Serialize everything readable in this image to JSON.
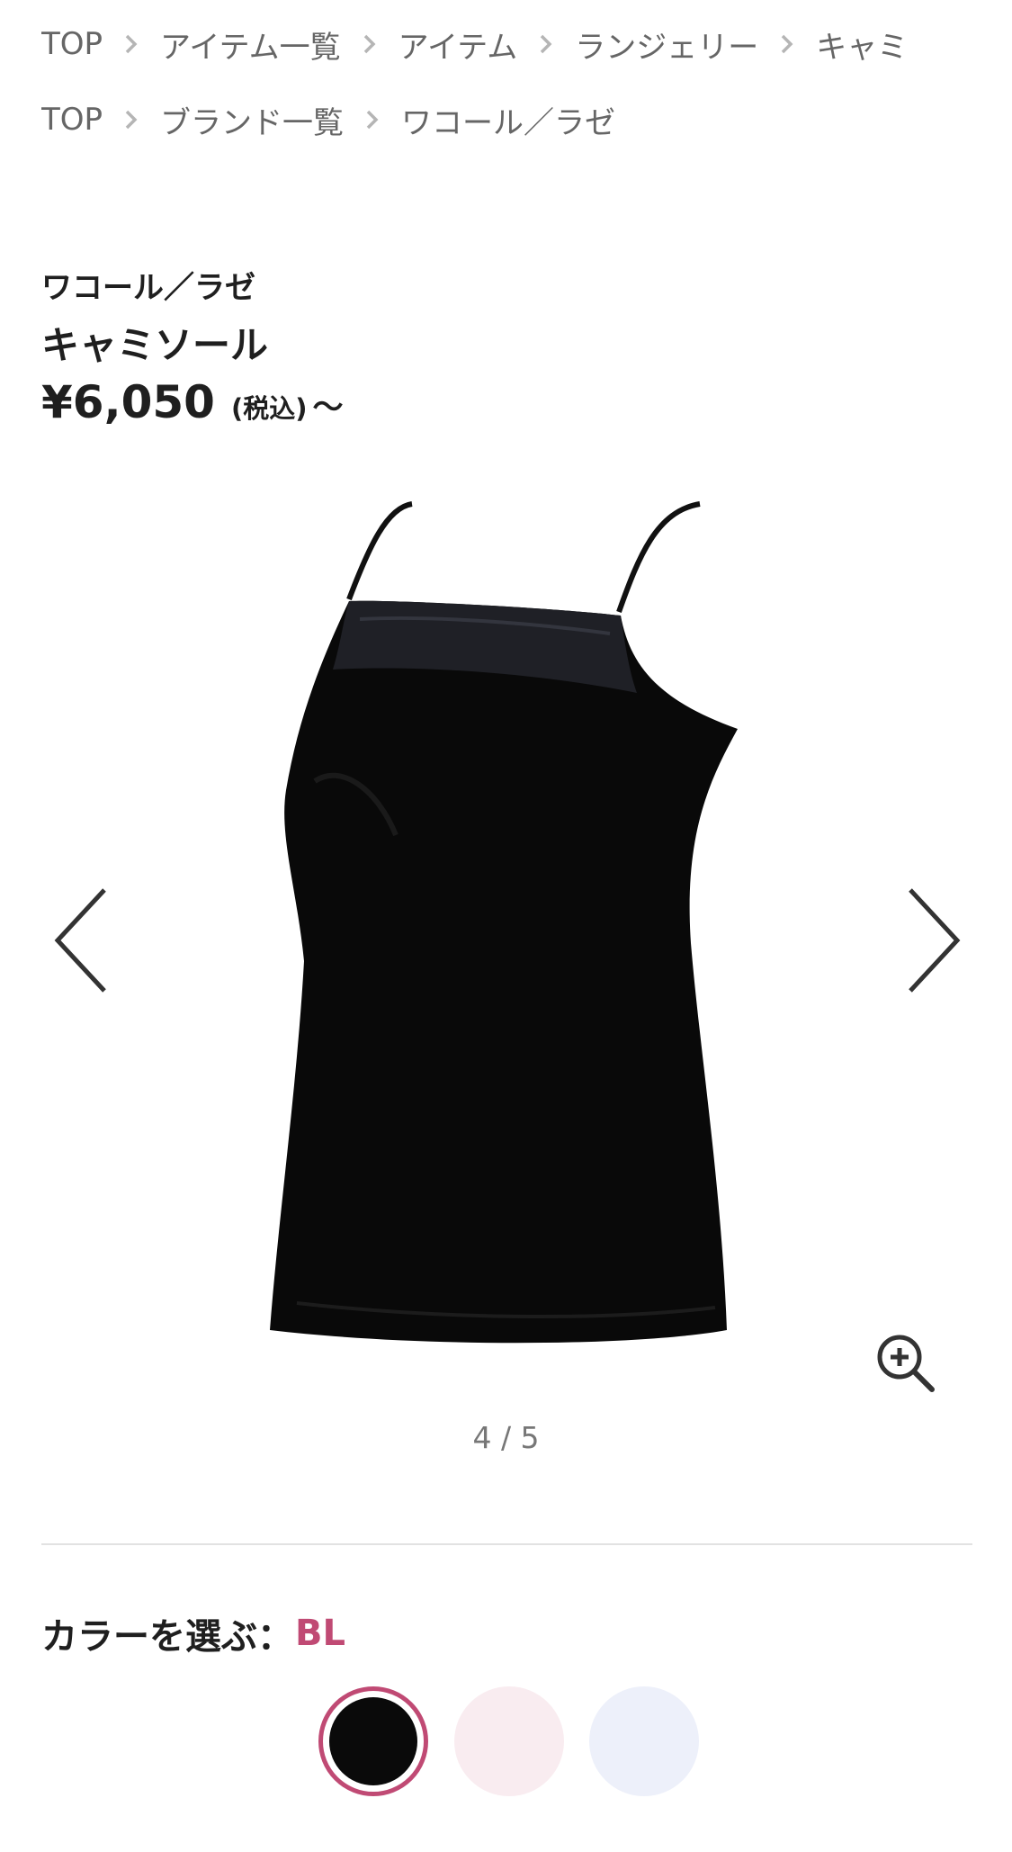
{
  "breadcrumbs_row1": [
    "TOP",
    "アイテム一覧",
    "アイテム",
    "ランジェリー",
    "キャミ"
  ],
  "breadcrumbs_row2": [
    "TOP",
    "ブランド一覧",
    "ワコール／ラゼ"
  ],
  "product": {
    "brand": "ワコール／ラゼ",
    "name": "キャミソール",
    "price": "¥6,050",
    "tax_note": "(税込)",
    "price_suffix": "〜"
  },
  "gallery": {
    "counter": "4 / 5",
    "current": 4,
    "total": 5,
    "image": "black camisole with satin trim",
    "prev_icon": "chevron-left-icon",
    "next_icon": "chevron-right-icon",
    "zoom_icon": "zoom-in-icon"
  },
  "color": {
    "label": "カラーを選ぶ：",
    "selected": "BL",
    "swatches": [
      {
        "color": "#0a0a0a",
        "selected": true
      },
      {
        "color": "#f9ecf0",
        "selected": false
      },
      {
        "color": "#edf0fa",
        "selected": false
      }
    ],
    "accent": "#c04a74"
  }
}
